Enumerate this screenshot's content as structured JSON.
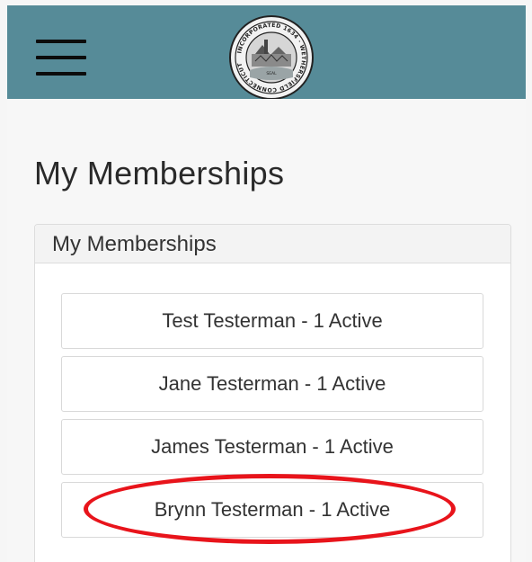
{
  "header": {
    "menu_icon": "hamburger-menu-icon",
    "logo_icon": "town-seal-icon",
    "colors": {
      "header_background": "#568b98"
    },
    "seal": {
      "ring_text": "INCORPORATED 1634 · WETHERSFIELD CONNECTICUT",
      "center_text": "SEAL"
    }
  },
  "main": {
    "page_title": "My Memberships",
    "panel": {
      "heading": "My Memberships",
      "items": [
        {
          "label": "Test Testerman - 1 Active"
        },
        {
          "label": "Jane Testerman - 1 Active"
        },
        {
          "label": "James Testerman - 1 Active"
        },
        {
          "label": "Brynn Testerman - 1 Active"
        }
      ]
    }
  },
  "annotation": {
    "highlight_color": "#e8141b"
  }
}
